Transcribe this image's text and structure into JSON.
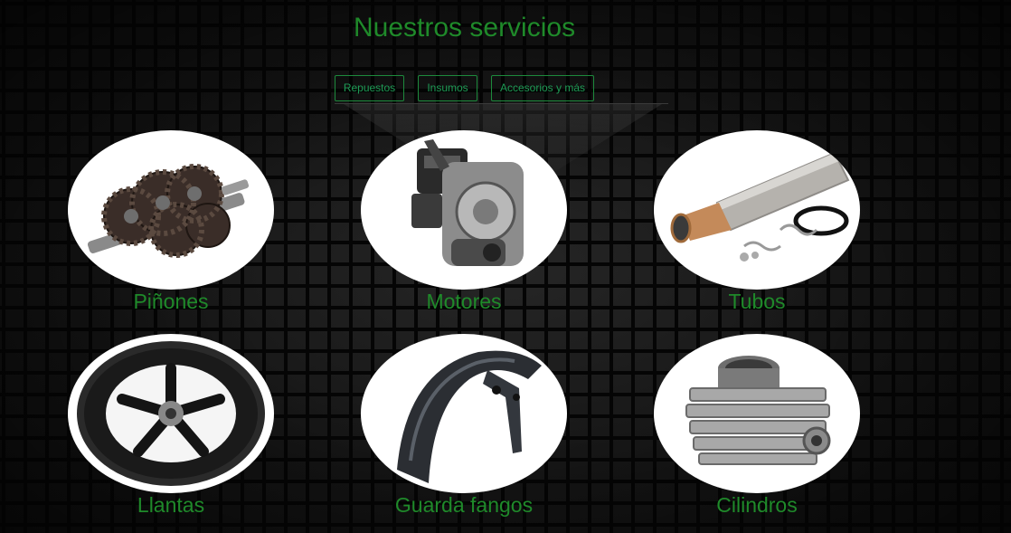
{
  "header": {
    "title": "Nuestros servicios"
  },
  "tabs": [
    {
      "label": "Repuestos"
    },
    {
      "label": "Insumos"
    },
    {
      "label": "Accesorios y más"
    }
  ],
  "services": [
    {
      "label": "Piñones",
      "icon": "gears-image"
    },
    {
      "label": "Motores",
      "icon": "engine-image"
    },
    {
      "label": "Tubos",
      "icon": "exhaust-pipe-image"
    },
    {
      "label": "Llantas",
      "icon": "tire-image"
    },
    {
      "label": "Guarda fangos",
      "icon": "fender-image"
    },
    {
      "label": "Cilindros",
      "icon": "cylinder-image"
    }
  ],
  "colors": {
    "accent": "#1f8a2a",
    "tab_border": "#1d8a3c",
    "background": "#0b0b0b"
  }
}
